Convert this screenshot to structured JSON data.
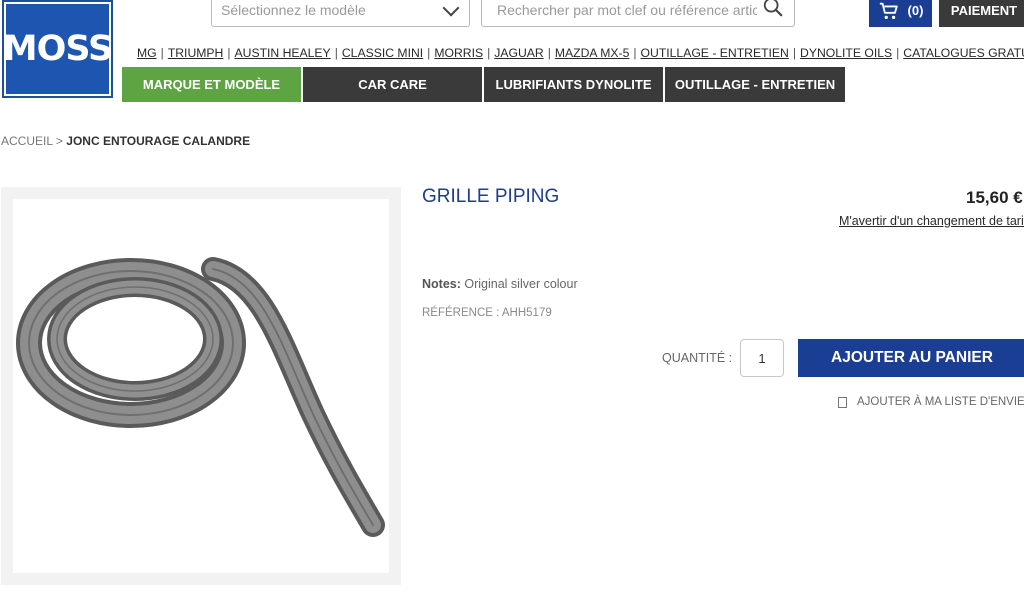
{
  "logo": {
    "text": "MOSS"
  },
  "topbar": {
    "model_placeholder": "Sélectionnez le modèle",
    "search_placeholder": "Rechercher par mot clef ou référence article",
    "cart_count": "(0)",
    "checkout_label": "PAIEMENT"
  },
  "brand_links": [
    "MG",
    "TRIUMPH",
    "AUSTIN HEALEY",
    "CLASSIC MINI",
    "MORRIS",
    "JAGUAR",
    "MAZDA MX-5",
    "OUTILLAGE - ENTRETIEN",
    "DYNOLITE OILS",
    "CATALOGUES GRATUITS"
  ],
  "mainnav": [
    {
      "label": "MARQUE ET MODÈLE",
      "active": true
    },
    {
      "label": "CAR CARE",
      "active": false
    },
    {
      "label": "LUBRIFIANTS DYNOLITE",
      "active": false
    },
    {
      "label": "OUTILLAGE - ENTRETIEN",
      "active": false
    }
  ],
  "breadcrumb": {
    "home": "ACCUEIL",
    "separator": ">",
    "current": "JONC ENTOURAGE CALANDRE"
  },
  "product": {
    "title": "GRILLE PIPING",
    "price": "15,60 €",
    "price_alert": "M'avertir d'un changement de tarif",
    "notes_label": "Notes:",
    "notes_value": "Original silver colour",
    "reference": "RÉFÉRENCE : AHH5179",
    "quantity_label": "QUANTITÉ :",
    "quantity_value": "1",
    "add_to_cart": "AJOUTER AU PANIER",
    "wishlist": "AJOUTER À MA LISTE D'ENVIES"
  },
  "colors": {
    "brand_blue": "#1d55b0",
    "button_blue": "#1a3e94",
    "nav_green": "#5ea442",
    "nav_dark": "#3a3a3a",
    "title_blue": "#1f3d8a"
  }
}
